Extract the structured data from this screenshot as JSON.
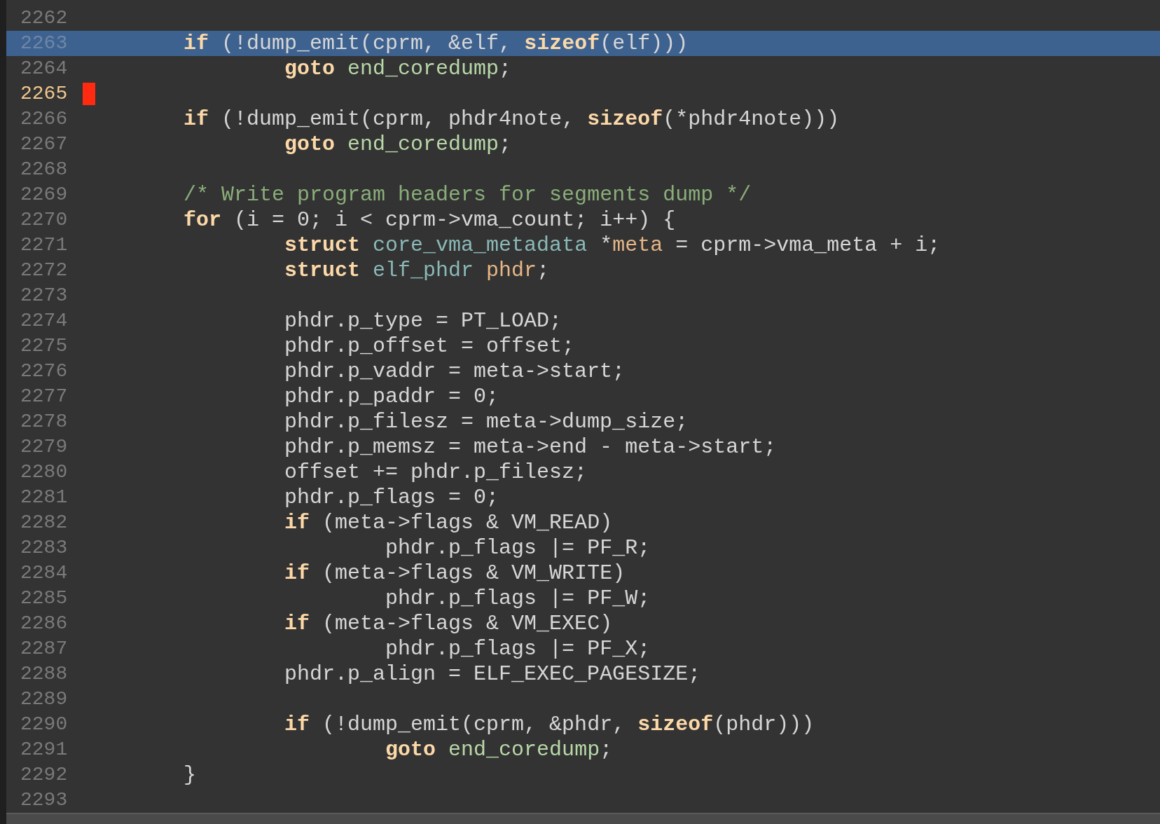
{
  "editor": {
    "lines": [
      {
        "number": "2262",
        "highlighted": false,
        "cursor": false
      },
      {
        "number": "2263",
        "highlighted": true,
        "cursor": false,
        "segments": [
          {
            "kind": "keyword",
            "text": "\tif"
          },
          {
            "kind": "plain",
            "text": " (!dump_emit(cprm, &elf, "
          },
          {
            "kind": "keyword",
            "text": "sizeof"
          },
          {
            "kind": "plain",
            "text": "(elf)))"
          }
        ]
      },
      {
        "number": "2264",
        "highlighted": false,
        "cursor": false,
        "segments": [
          {
            "kind": "keyword",
            "text": "\t\tgoto"
          },
          {
            "kind": "label",
            "text": " end_coredump"
          },
          {
            "kind": "plain",
            "text": ";"
          }
        ]
      },
      {
        "number": "2265",
        "highlighted": false,
        "cursor": true
      },
      {
        "number": "2266",
        "highlighted": false,
        "cursor": false,
        "segments": [
          {
            "kind": "keyword",
            "text": "\tif"
          },
          {
            "kind": "plain",
            "text": " (!dump_emit(cprm, phdr4note, "
          },
          {
            "kind": "keyword",
            "text": "sizeof"
          },
          {
            "kind": "plain",
            "text": "(*phdr4note)))"
          }
        ]
      },
      {
        "number": "2267",
        "highlighted": false,
        "cursor": false,
        "segments": [
          {
            "kind": "keyword",
            "text": "\t\tgoto"
          },
          {
            "kind": "label",
            "text": " end_coredump"
          },
          {
            "kind": "plain",
            "text": ";"
          }
        ]
      },
      {
        "number": "2268",
        "highlighted": false,
        "cursor": false
      },
      {
        "number": "2269",
        "highlighted": false,
        "cursor": false,
        "segments": [
          {
            "kind": "comment",
            "text": "\t/* Write program headers for segments dump */"
          }
        ]
      },
      {
        "number": "2270",
        "highlighted": false,
        "cursor": false,
        "segments": [
          {
            "kind": "keyword",
            "text": "\tfor"
          },
          {
            "kind": "plain",
            "text": " (i = 0; i < cprm->vma_count; i++) {"
          }
        ]
      },
      {
        "number": "2271",
        "highlighted": false,
        "cursor": false,
        "segments": [
          {
            "kind": "keyword",
            "text": "\t\tstruct"
          },
          {
            "kind": "type",
            "text": " core_vma_metadata"
          },
          {
            "kind": "plain",
            "text": " *"
          },
          {
            "kind": "variable",
            "text": "meta"
          },
          {
            "kind": "plain",
            "text": " = cprm->vma_meta + i;"
          }
        ]
      },
      {
        "number": "2272",
        "highlighted": false,
        "cursor": false,
        "segments": [
          {
            "kind": "keyword",
            "text": "\t\tstruct"
          },
          {
            "kind": "type",
            "text": " elf_phdr"
          },
          {
            "kind": "variable",
            "text": " phdr"
          },
          {
            "kind": "plain",
            "text": ";"
          }
        ]
      },
      {
        "number": "2273",
        "highlighted": false,
        "cursor": false
      },
      {
        "number": "2274",
        "highlighted": false,
        "cursor": false,
        "segments": [
          {
            "kind": "plain",
            "text": "\t\tphdr.p_type = PT_LOAD;"
          }
        ]
      },
      {
        "number": "2275",
        "highlighted": false,
        "cursor": false,
        "segments": [
          {
            "kind": "plain",
            "text": "\t\tphdr.p_offset = offset;"
          }
        ]
      },
      {
        "number": "2276",
        "highlighted": false,
        "cursor": false,
        "segments": [
          {
            "kind": "plain",
            "text": "\t\tphdr.p_vaddr = meta->start;"
          }
        ]
      },
      {
        "number": "2277",
        "highlighted": false,
        "cursor": false,
        "segments": [
          {
            "kind": "plain",
            "text": "\t\tphdr.p_paddr = 0;"
          }
        ]
      },
      {
        "number": "2278",
        "highlighted": false,
        "cursor": false,
        "segments": [
          {
            "kind": "plain",
            "text": "\t\tphdr.p_filesz = meta->dump_size;"
          }
        ]
      },
      {
        "number": "2279",
        "highlighted": false,
        "cursor": false,
        "segments": [
          {
            "kind": "plain",
            "text": "\t\tphdr.p_memsz = meta->end - meta->start;"
          }
        ]
      },
      {
        "number": "2280",
        "highlighted": false,
        "cursor": false,
        "segments": [
          {
            "kind": "plain",
            "text": "\t\toffset += phdr.p_filesz;"
          }
        ]
      },
      {
        "number": "2281",
        "highlighted": false,
        "cursor": false,
        "segments": [
          {
            "kind": "plain",
            "text": "\t\tphdr.p_flags = 0;"
          }
        ]
      },
      {
        "number": "2282",
        "highlighted": false,
        "cursor": false,
        "segments": [
          {
            "kind": "keyword",
            "text": "\t\tif"
          },
          {
            "kind": "plain",
            "text": " (meta->flags & VM_READ)"
          }
        ]
      },
      {
        "number": "2283",
        "highlighted": false,
        "cursor": false,
        "segments": [
          {
            "kind": "plain",
            "text": "\t\t\tphdr.p_flags |= PF_R;"
          }
        ]
      },
      {
        "number": "2284",
        "highlighted": false,
        "cursor": false,
        "segments": [
          {
            "kind": "keyword",
            "text": "\t\tif"
          },
          {
            "kind": "plain",
            "text": " (meta->flags & VM_WRITE)"
          }
        ]
      },
      {
        "number": "2285",
        "highlighted": false,
        "cursor": false,
        "segments": [
          {
            "kind": "plain",
            "text": "\t\t\tphdr.p_flags |= PF_W;"
          }
        ]
      },
      {
        "number": "2286",
        "highlighted": false,
        "cursor": false,
        "segments": [
          {
            "kind": "keyword",
            "text": "\t\tif"
          },
          {
            "kind": "plain",
            "text": " (meta->flags & VM_EXEC)"
          }
        ]
      },
      {
        "number": "2287",
        "highlighted": false,
        "cursor": false,
        "segments": [
          {
            "kind": "plain",
            "text": "\t\t\tphdr.p_flags |= PF_X;"
          }
        ]
      },
      {
        "number": "2288",
        "highlighted": false,
        "cursor": false,
        "segments": [
          {
            "kind": "plain",
            "text": "\t\tphdr.p_align = ELF_EXEC_PAGESIZE;"
          }
        ]
      },
      {
        "number": "2289",
        "highlighted": false,
        "cursor": false
      },
      {
        "number": "2290",
        "highlighted": false,
        "cursor": false,
        "segments": [
          {
            "kind": "keyword",
            "text": "\t\tif"
          },
          {
            "kind": "plain",
            "text": " (!dump_emit(cprm, &phdr, "
          },
          {
            "kind": "keyword",
            "text": "sizeof"
          },
          {
            "kind": "plain",
            "text": "(phdr)))"
          }
        ]
      },
      {
        "number": "2291",
        "highlighted": false,
        "cursor": false,
        "segments": [
          {
            "kind": "keyword",
            "text": "\t\t\tgoto"
          },
          {
            "kind": "label",
            "text": " end_coredump"
          },
          {
            "kind": "plain",
            "text": ";"
          }
        ]
      },
      {
        "number": "2292",
        "highlighted": false,
        "cursor": false,
        "segments": [
          {
            "kind": "plain",
            "text": "\t}"
          }
        ]
      },
      {
        "number": "2293",
        "highlighted": false,
        "cursor": false
      }
    ]
  }
}
